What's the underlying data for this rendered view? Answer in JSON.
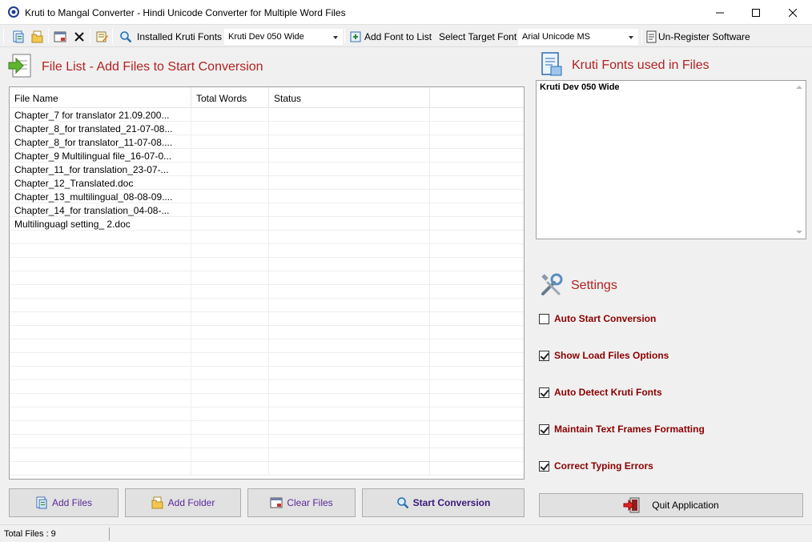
{
  "window": {
    "title": "Kruti to Mangal Converter - Hindi Unicode Converter for Multiple Word Files"
  },
  "toolbar": {
    "installed_fonts_label": "Installed Kruti Fonts",
    "installed_font_value": "Kruti Dev 050 Wide",
    "add_font_label": "Add Font to List",
    "target_font_label": "Select Target Font",
    "target_font_value": "Arial Unicode MS",
    "unregister_label": "Un-Register Software"
  },
  "file_list": {
    "title": "File List - Add Files to Start Conversion",
    "columns": [
      "File Name",
      "Total Words",
      "Status"
    ],
    "rows": [
      [
        "Chapter_7 for translator 21.09.200...",
        "",
        ""
      ],
      [
        "Chapter_8_for translated_21-07-08...",
        "",
        ""
      ],
      [
        "Chapter_8_for translator_11-07-08....",
        "",
        ""
      ],
      [
        "Chapter_9 Multilingual file_16-07-0...",
        "",
        ""
      ],
      [
        "Chapter_11_for translation_23-07-...",
        "",
        ""
      ],
      [
        "Chapter_12_Translated.doc",
        "",
        ""
      ],
      [
        "Chapter_13_multilingual_08-08-09....",
        "",
        ""
      ],
      [
        "Chapter_14_for translation_04-08-...",
        "",
        ""
      ],
      [
        "Multilinguagl setting_ 2.doc",
        "",
        ""
      ]
    ],
    "empty_rows": 18
  },
  "buttons": {
    "add_files": "Add Files",
    "add_folder": "Add Folder",
    "clear_files": "Clear Files",
    "start_conversion": "Start Conversion",
    "quit": "Quit Application"
  },
  "fonts_panel": {
    "title": "Kruti Fonts used in Files",
    "content": "Kruti Dev 050 Wide"
  },
  "settings": {
    "title": "Settings",
    "items": [
      {
        "label": "Auto Start Conversion",
        "checked": false
      },
      {
        "label": "Show Load Files Options",
        "checked": true
      },
      {
        "label": "Auto Detect Kruti Fonts",
        "checked": true
      },
      {
        "label": "Maintain Text Frames Formatting",
        "checked": true
      },
      {
        "label": "Correct Typing Errors",
        "checked": true
      }
    ]
  },
  "status": {
    "total_files": "Total Files :  9"
  },
  "colors": {
    "section_title": "#b22222",
    "setting_label": "#8b0000",
    "button_text": "#5a2a9a"
  }
}
